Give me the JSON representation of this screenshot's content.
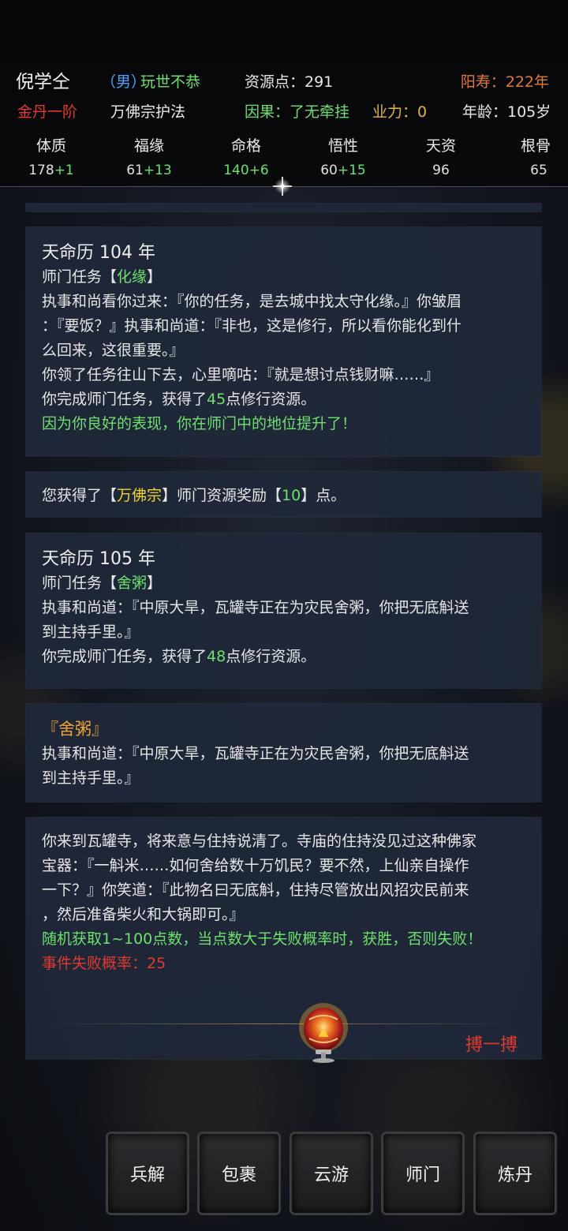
{
  "header": {
    "name": "倪学仝",
    "gender": "（男）",
    "trait": "玩世不恭",
    "resource": "资源点：291",
    "lifespan": "阳寿：222年",
    "realm": "金丹一阶",
    "title": "万佛宗护法",
    "karma": "因果：了无牵挂",
    "yeli": "业力：0",
    "age": "年龄：105岁"
  },
  "stats": [
    {
      "label": "体质",
      "base": "178",
      "bonus": "+1"
    },
    {
      "label": "福缘",
      "base": "61",
      "bonus": "+13"
    },
    {
      "label": "命格",
      "base": "140",
      "bonus": "+6"
    },
    {
      "label": "悟性",
      "base": "60",
      "bonus": "+15"
    },
    {
      "label": "天资",
      "base": "96",
      "bonus": ""
    },
    {
      "label": "根骨",
      "base": "65",
      "bonus": ""
    }
  ],
  "card1": {
    "year": "天命历 104 年",
    "task_prefix": "师门任务【",
    "task_name": "化缘",
    "task_suffix": "】",
    "l1": "执事和尚看你过来：『你的任务，是去城中找太守化缘。』你皱眉",
    "l2": "：『要饭？』执事和尚道：『非也，这是修行，所以看你能化到什",
    "l3": "么回来，这很重要。』",
    "l4": "你领了任务往山下去，心里嘀咕：『就是想讨点钱财嘛……』",
    "l5a": "你完成师门任务，获得了",
    "l5n": "45",
    "l5b": "点修行资源。",
    "l6": "因为你良好的表现，你在师门中的地位提升了！"
  },
  "card2": {
    "a": "您获得了【",
    "sect": "万佛宗",
    "b": "】师门资源奖励【",
    "n": "10",
    "c": "】点。"
  },
  "card3": {
    "year": "天命历 105 年",
    "task_prefix": "师门任务【",
    "task_name": "舍粥",
    "task_suffix": "】",
    "l1": "执事和尚道：『中原大旱，瓦罐寺正在为灾民舍粥，你把无底斛送",
    "l2": "到主持手里。』",
    "l3a": "你完成师门任务，获得了",
    "l3n": "48",
    "l3b": "点修行资源。"
  },
  "card4": {
    "title": "『舍粥』",
    "l1": "执事和尚道：『中原大旱，瓦罐寺正在为灾民舍粥，你把无底斛送",
    "l2": "到主持手里。』"
  },
  "card5": {
    "l1": "你来到瓦罐寺，将来意与住持说清了。寺庙的住持没见过这种佛家",
    "l2": "宝器：『一斛米……如何舍给数十万饥民？要不然，上仙亲自操作",
    "l3": "一下？』你笑道：『此物名曰无底斛，住持尽管放出风招灾民前来",
    "l4": "，然后准备柴火和大锅即可。』",
    "rule": "随机获取1~100点数，当点数大于失败概率时，获胜，否则失败！",
    "fail": "事件失败概率：25",
    "action": "搏一搏"
  },
  "nav": [
    "兵解",
    "包裹",
    "云游",
    "师门",
    "炼丹"
  ]
}
